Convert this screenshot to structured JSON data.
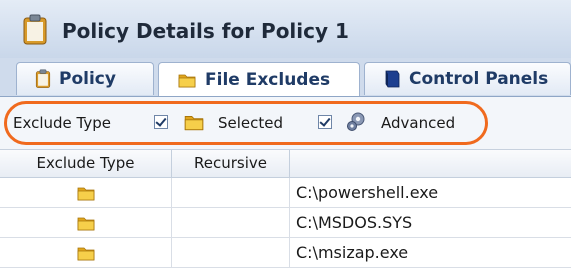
{
  "window": {
    "title": "Policy Details for Policy 1",
    "icon": "clipboard-icon"
  },
  "tabs": [
    {
      "label": "Policy",
      "icon": "clipboard-icon",
      "active": false
    },
    {
      "label": "File Excludes",
      "icon": "folder-icon",
      "active": true
    },
    {
      "label": "Control Panels",
      "icon": "book-icon",
      "active": false
    }
  ],
  "toolbar": {
    "label": "Exclude Type",
    "options": [
      {
        "label": "Selected",
        "checked": true,
        "icon": "folder-icon"
      },
      {
        "label": "Advanced",
        "checked": true,
        "icon": "gear-icon"
      }
    ],
    "highlight_color": "#f06a1e"
  },
  "table": {
    "columns": [
      "Exclude Type",
      "Recursive",
      ""
    ],
    "rows": [
      {
        "type_icon": "folder-icon",
        "recursive": "",
        "path": "C:\\powershell.exe"
      },
      {
        "type_icon": "folder-icon",
        "recursive": "",
        "path": "C:\\MSDOS.SYS"
      },
      {
        "type_icon": "folder-icon",
        "recursive": "",
        "path": "C:\\msizap.exe"
      }
    ]
  },
  "colors": {
    "accent": "#1f3b66",
    "folder": "#f2c338",
    "header_bg": "#c9d7ea"
  }
}
